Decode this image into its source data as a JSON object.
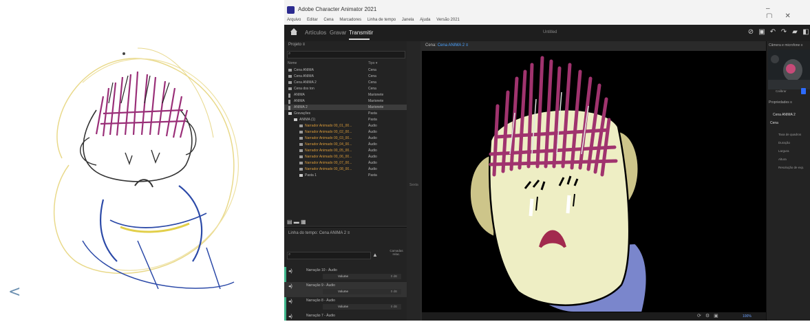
{
  "app": {
    "title": "Adobe Character Animator 2021",
    "menu": [
      "Arquivo",
      "Editar",
      "Cena",
      "Marcadores",
      "Linha de tempo",
      "Janela",
      "Ajuda",
      "Versão 2021"
    ],
    "window_controls": [
      "–",
      "▢",
      "✕"
    ],
    "workspace_tabs": [
      "Artículos",
      "Gravar",
      "Transmitir"
    ],
    "active_tab": "Transmitir",
    "document_name": "Untitled"
  },
  "project": {
    "title": "Projeto  ≡",
    "columns": {
      "name": "Nome",
      "type": "Tipo ▾"
    },
    "rows": [
      {
        "name": "Cena ANIMA",
        "type": "Cena",
        "kind": "scene"
      },
      {
        "name": "Cena ANIMA",
        "type": "Cena",
        "kind": "scene"
      },
      {
        "name": "Cena ANIMA 2",
        "type": "Cena",
        "kind": "scene"
      },
      {
        "name": "Cena dos ton",
        "type": "Cena",
        "kind": "scene"
      },
      {
        "name": "ANIMA",
        "type": "Marionete",
        "kind": "puppet"
      },
      {
        "name": "ANIMA",
        "type": "Marionete",
        "kind": "puppet"
      },
      {
        "name": "ANIMA 2",
        "type": "Marionete",
        "kind": "puppet",
        "selected": true
      },
      {
        "name": "Gravações",
        "type": "Pasta",
        "kind": "folder"
      },
      {
        "name": "ANIMA (1)",
        "type": "Pasta",
        "kind": "folder"
      },
      {
        "name": "Narrador Animado 00_01_00...",
        "type": "Áudio",
        "kind": "audio"
      },
      {
        "name": "Narrador Animado 00_02_00...",
        "type": "Áudio",
        "kind": "audio"
      },
      {
        "name": "Narrador Animado 00_03_00...",
        "type": "Áudio",
        "kind": "audio"
      },
      {
        "name": "Narrador Animado 00_04_00...",
        "type": "Áudio",
        "kind": "audio"
      },
      {
        "name": "Narrador Animado 00_05_00...",
        "type": "Áudio",
        "kind": "audio"
      },
      {
        "name": "Narrador Animado 00_06_00...",
        "type": "Áudio",
        "kind": "audio"
      },
      {
        "name": "Narrador Animado 00_07_00...",
        "type": "Áudio",
        "kind": "audio"
      },
      {
        "name": "Narrador Animado 00_08_00...",
        "type": "Áudio",
        "kind": "audio"
      },
      {
        "name": "Pasta 1",
        "type": "Pasta",
        "kind": "folder"
      }
    ]
  },
  "timeline": {
    "title": "Linha do tempo: Cena ANIMA 2  ≡",
    "sort_label": "Camadas relac.",
    "rows": [
      {
        "name": "Narração 10 - Áudio",
        "volume_label": "Volume",
        "volume_value": "0 dB"
      },
      {
        "name": "Narração 9 - Áudio",
        "volume_label": "Volume",
        "volume_value": "0 dB",
        "selected": true
      },
      {
        "name": "Narração 8 - Áudio",
        "volume_label": "Volume",
        "volume_value": "0 dB"
      },
      {
        "name": "Narração 7 - Áudio",
        "volume_label": "",
        "volume_value": ""
      }
    ]
  },
  "scene": {
    "title_prefix": "Cena: ",
    "title_link": "Cena ANIMA 2  ≡",
    "zoom": "100%",
    "split_label": "Sexta"
  },
  "right": {
    "camera_title": "Câmera e microfone  ≡",
    "camera_toggle": "Calibrar",
    "props_title": "Propriedades  ≡",
    "props_scene": "Cena ANIMA 2",
    "props_section": "Cena",
    "props_items": [
      "Taxa de quadros",
      "Duração",
      "Largura",
      "Altura",
      "Resolução de exp."
    ]
  },
  "colors": {
    "hair": "#a0336e",
    "face": "#eeeec4",
    "ear": "#cdc58a",
    "shirt": "#7a86cc",
    "mouth": "#a22a4e",
    "accent": "#2d6bff"
  },
  "left": {
    "back_glyph": "<"
  }
}
